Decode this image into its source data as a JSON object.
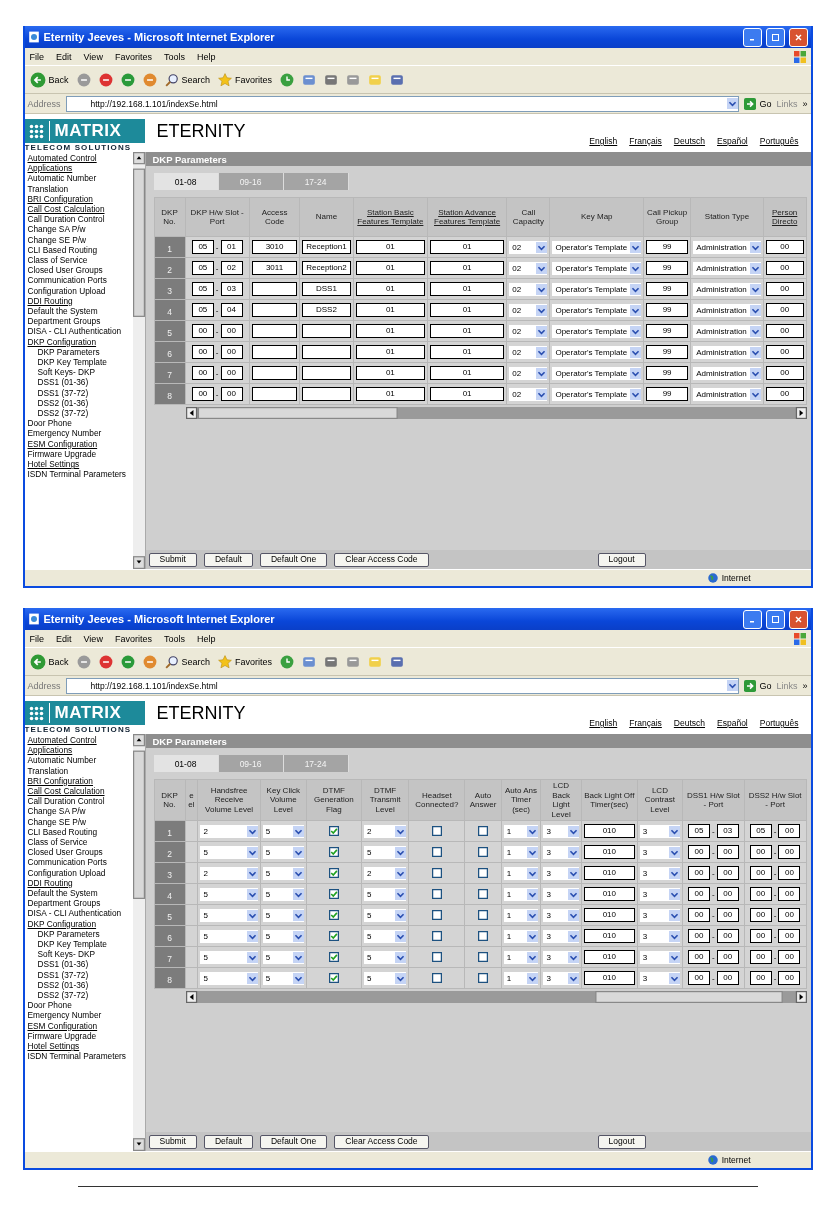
{
  "screens": [
    {
      "window": {
        "title": "Eternity Jeeves - Microsoft Internet Explorer"
      },
      "menu": [
        "File",
        "Edit",
        "View",
        "Favorites",
        "Tools",
        "Help"
      ],
      "toolbar": {
        "back": "Back",
        "search": "Search",
        "favorites": "Favorites"
      },
      "address": {
        "label": "Address",
        "url": "http://192.168.1.101/indexSe.html",
        "go": "Go",
        "links": "Links",
        "more": "»"
      },
      "logo": {
        "name": "MATRIX",
        "tagline": "TELECOM SOLUTIONS"
      },
      "product": "ETERNITY",
      "languages": [
        "English",
        "Français",
        "Deutsch",
        "Español",
        "Português"
      ],
      "sidebar": {
        "items": [
          {
            "label": "Automated Control Applications",
            "underlined": true
          },
          {
            "label": "Automatic Number Translation",
            "underlined": false
          },
          {
            "label": "BRI Configuration",
            "underlined": true
          },
          {
            "label": "Call Cost Calculation",
            "underlined": true
          },
          {
            "label": "Call Duration Control",
            "underlined": false
          },
          {
            "label": "Change SA P/w",
            "underlined": false
          },
          {
            "label": "Change SE P/w",
            "underlined": false
          },
          {
            "label": "CLI Based Routing",
            "underlined": false
          },
          {
            "label": "Class of Service",
            "underlined": false
          },
          {
            "label": "Closed User Groups",
            "underlined": false
          },
          {
            "label": "Communication Ports",
            "underlined": false
          },
          {
            "label": "Configuration Upload",
            "underlined": false
          },
          {
            "label": "DDI Routing",
            "underlined": true
          },
          {
            "label": "Default the System",
            "underlined": false
          },
          {
            "label": "Department Groups",
            "underlined": false
          },
          {
            "label": "DISA - CLI Authentication",
            "underlined": false
          },
          {
            "label": "DKP Configuration",
            "underlined": true,
            "children": [
              {
                "label": "DKP Parameters",
                "underlined": false
              },
              {
                "label": "DKP Key Template",
                "underlined": false
              },
              {
                "label": "Soft Keys- DKP",
                "underlined": false
              },
              {
                "label": "DSS1 (01-36)",
                "underlined": false
              },
              {
                "label": "DSS1 (37-72)",
                "underlined": false
              },
              {
                "label": "DSS2 (01-36)",
                "underlined": false
              },
              {
                "label": "DSS2 (37-72)",
                "underlined": false
              }
            ]
          },
          {
            "label": "Door Phone",
            "underlined": false
          },
          {
            "label": "Emergency Number",
            "underlined": false
          },
          {
            "label": "ESM Configuration",
            "underlined": true
          },
          {
            "label": "Firmware Upgrade",
            "underlined": false
          },
          {
            "label": "Hotel Settings",
            "underlined": true
          },
          {
            "label": "ISDN Terminal Parameters",
            "underlined": false
          }
        ]
      },
      "panel": {
        "title": "DKP Parameters",
        "tabs": [
          {
            "label": "01-08",
            "selected": true
          },
          {
            "label": "09-16",
            "selected": false
          },
          {
            "label": "17-24",
            "selected": false
          }
        ],
        "table": {
          "columns": [
            {
              "label": "DKP No.",
              "underlined": false
            },
            {
              "label": "DKP H/w Slot - Port",
              "underlined": false
            },
            {
              "label": "Access Code",
              "underlined": false
            },
            {
              "label": "Name",
              "underlined": false
            },
            {
              "label": "Station Basic Features Template",
              "underlined": true
            },
            {
              "label": "Station Advance Features Template",
              "underlined": true
            },
            {
              "label": "Call Capacity",
              "underlined": false
            },
            {
              "label": "Key Map",
              "underlined": false
            },
            {
              "label": "Call Pickup Group",
              "underlined": false
            },
            {
              "label": "Station Type",
              "underlined": false
            },
            {
              "label": "Person Directo",
              "underlined": true
            }
          ],
          "rows": [
            {
              "cells": [
                {
                  "kind": "number",
                  "value": "1"
                },
                {
                  "kind": "pair",
                  "values": [
                    "05",
                    "01"
                  ],
                  "separator": "-"
                },
                {
                  "kind": "input",
                  "value": "3010"
                },
                {
                  "kind": "input",
                  "value": "Reception1"
                },
                {
                  "kind": "input",
                  "value": "01"
                },
                {
                  "kind": "input",
                  "value": "01"
                },
                {
                  "kind": "select",
                  "value": "02"
                },
                {
                  "kind": "select",
                  "value": "Operator's Template"
                },
                {
                  "kind": "input",
                  "value": "99"
                },
                {
                  "kind": "select",
                  "value": "Administration"
                },
                {
                  "kind": "input",
                  "value": "00"
                }
              ]
            },
            {
              "cells": [
                {
                  "kind": "number",
                  "value": "2"
                },
                {
                  "kind": "pair",
                  "values": [
                    "05",
                    "02"
                  ],
                  "separator": "-"
                },
                {
                  "kind": "input",
                  "value": "3011"
                },
                {
                  "kind": "input",
                  "value": "Reception2"
                },
                {
                  "kind": "input",
                  "value": "01"
                },
                {
                  "kind": "input",
                  "value": "01"
                },
                {
                  "kind": "select",
                  "value": "02"
                },
                {
                  "kind": "select",
                  "value": "Operator's Template"
                },
                {
                  "kind": "input",
                  "value": "99"
                },
                {
                  "kind": "select",
                  "value": "Administration"
                },
                {
                  "kind": "input",
                  "value": "00"
                }
              ]
            },
            {
              "cells": [
                {
                  "kind": "number",
                  "value": "3"
                },
                {
                  "kind": "pair",
                  "values": [
                    "05",
                    "03"
                  ],
                  "separator": "-"
                },
                {
                  "kind": "input"
                },
                {
                  "kind": "input",
                  "value": "DSS1"
                },
                {
                  "kind": "input",
                  "value": "01"
                },
                {
                  "kind": "input",
                  "value": "01"
                },
                {
                  "kind": "select",
                  "value": "02"
                },
                {
                  "kind": "select",
                  "value": "Operator's Template"
                },
                {
                  "kind": "input",
                  "value": "99"
                },
                {
                  "kind": "select",
                  "value": "Administration"
                },
                {
                  "kind": "input",
                  "value": "00"
                }
              ]
            },
            {
              "cells": [
                {
                  "kind": "number",
                  "value": "4"
                },
                {
                  "kind": "pair",
                  "values": [
                    "05",
                    "04"
                  ],
                  "separator": "-"
                },
                {
                  "kind": "input"
                },
                {
                  "kind": "input",
                  "value": "DSS2"
                },
                {
                  "kind": "input",
                  "value": "01"
                },
                {
                  "kind": "input",
                  "value": "01"
                },
                {
                  "kind": "select",
                  "value": "02"
                },
                {
                  "kind": "select",
                  "value": "Operator's Template"
                },
                {
                  "kind": "input",
                  "value": "99"
                },
                {
                  "kind": "select",
                  "value": "Administration"
                },
                {
                  "kind": "input",
                  "value": "00"
                }
              ]
            },
            {
              "cells": [
                {
                  "kind": "number",
                  "value": "5"
                },
                {
                  "kind": "pair",
                  "values": [
                    "00",
                    "00"
                  ],
                  "separator": "-"
                },
                {
                  "kind": "input"
                },
                {
                  "kind": "input"
                },
                {
                  "kind": "input",
                  "value": "01"
                },
                {
                  "kind": "input",
                  "value": "01"
                },
                {
                  "kind": "select",
                  "value": "02"
                },
                {
                  "kind": "select",
                  "value": "Operator's Template"
                },
                {
                  "kind": "input",
                  "value": "99"
                },
                {
                  "kind": "select",
                  "value": "Administration"
                },
                {
                  "kind": "input",
                  "value": "00"
                }
              ]
            },
            {
              "cells": [
                {
                  "kind": "number",
                  "value": "6"
                },
                {
                  "kind": "pair",
                  "values": [
                    "00",
                    "00"
                  ],
                  "separator": "-"
                },
                {
                  "kind": "input"
                },
                {
                  "kind": "input"
                },
                {
                  "kind": "input",
                  "value": "01"
                },
                {
                  "kind": "input",
                  "value": "01"
                },
                {
                  "kind": "select",
                  "value": "02"
                },
                {
                  "kind": "select",
                  "value": "Operator's Template"
                },
                {
                  "kind": "input",
                  "value": "99"
                },
                {
                  "kind": "select",
                  "value": "Administration"
                },
                {
                  "kind": "input",
                  "value": "00"
                }
              ]
            },
            {
              "cells": [
                {
                  "kind": "number",
                  "value": "7"
                },
                {
                  "kind": "pair",
                  "values": [
                    "00",
                    "00"
                  ],
                  "separator": "-"
                },
                {
                  "kind": "input"
                },
                {
                  "kind": "input"
                },
                {
                  "kind": "input",
                  "value": "01"
                },
                {
                  "kind": "input",
                  "value": "01"
                },
                {
                  "kind": "select",
                  "value": "02"
                },
                {
                  "kind": "select",
                  "value": "Operator's Template"
                },
                {
                  "kind": "input",
                  "value": "99"
                },
                {
                  "kind": "select",
                  "value": "Administration"
                },
                {
                  "kind": "input",
                  "value": "00"
                }
              ]
            },
            {
              "cells": [
                {
                  "kind": "number",
                  "value": "8"
                },
                {
                  "kind": "pair",
                  "values": [
                    "00",
                    "00"
                  ],
                  "separator": "-"
                },
                {
                  "kind": "input"
                },
                {
                  "kind": "input"
                },
                {
                  "kind": "input",
                  "value": "01"
                },
                {
                  "kind": "input",
                  "value": "01"
                },
                {
                  "kind": "select",
                  "value": "02"
                },
                {
                  "kind": "select",
                  "value": "Operator's Template"
                },
                {
                  "kind": "input",
                  "value": "99"
                },
                {
                  "kind": "select",
                  "value": "Administration"
                },
                {
                  "kind": "input",
                  "value": "00"
                }
              ]
            }
          ]
        },
        "buttons": [
          "Submit",
          "Default",
          "Default One",
          "Clear Access Code"
        ],
        "logout": "Logout"
      },
      "status_bar": {
        "zone": "Internet"
      }
    },
    {
      "window": {
        "title": "Eternity Jeeves - Microsoft Internet Explorer"
      },
      "menu": [
        "File",
        "Edit",
        "View",
        "Favorites",
        "Tools",
        "Help"
      ],
      "toolbar": {
        "back": "Back",
        "search": "Search",
        "favorites": "Favorites"
      },
      "address": {
        "label": "Address",
        "url": "http://192.168.1.101/indexSe.html",
        "go": "Go",
        "links": "Links",
        "more": "»"
      },
      "logo": {
        "name": "MATRIX",
        "tagline": "TELECOM SOLUTIONS"
      },
      "product": "ETERNITY",
      "languages": [
        "English",
        "Français",
        "Deutsch",
        "Español",
        "Português"
      ],
      "sidebar": {
        "items": [
          {
            "label": "Automated Control Applications",
            "underlined": true
          },
          {
            "label": "Automatic Number Translation",
            "underlined": false
          },
          {
            "label": "BRI Configuration",
            "underlined": true
          },
          {
            "label": "Call Cost Calculation",
            "underlined": true
          },
          {
            "label": "Call Duration Control",
            "underlined": false
          },
          {
            "label": "Change SA P/w",
            "underlined": false
          },
          {
            "label": "Change SE P/w",
            "underlined": false
          },
          {
            "label": "CLI Based Routing",
            "underlined": false
          },
          {
            "label": "Class of Service",
            "underlined": false
          },
          {
            "label": "Closed User Groups",
            "underlined": false
          },
          {
            "label": "Communication Ports",
            "underlined": false
          },
          {
            "label": "Configuration Upload",
            "underlined": false
          },
          {
            "label": "DDI Routing",
            "underlined": true
          },
          {
            "label": "Default the System",
            "underlined": false
          },
          {
            "label": "Department Groups",
            "underlined": false
          },
          {
            "label": "DISA - CLI Authentication",
            "underlined": false
          },
          {
            "label": "DKP Configuration",
            "underlined": true,
            "children": [
              {
                "label": "DKP Parameters",
                "underlined": false
              },
              {
                "label": "DKP Key Template",
                "underlined": false
              },
              {
                "label": "Soft Keys- DKP",
                "underlined": false
              },
              {
                "label": "DSS1 (01-36)",
                "underlined": false
              },
              {
                "label": "DSS1 (37-72)",
                "underlined": false
              },
              {
                "label": "DSS2 (01-36)",
                "underlined": false
              },
              {
                "label": "DSS2 (37-72)",
                "underlined": false
              }
            ]
          },
          {
            "label": "Door Phone",
            "underlined": false
          },
          {
            "label": "Emergency Number",
            "underlined": false
          },
          {
            "label": "ESM Configuration",
            "underlined": true
          },
          {
            "label": "Firmware Upgrade",
            "underlined": false
          },
          {
            "label": "Hotel Settings",
            "underlined": true
          },
          {
            "label": "ISDN Terminal Parameters",
            "underlined": false
          }
        ]
      },
      "panel": {
        "title": "DKP Parameters",
        "tabs": [
          {
            "label": "01-08",
            "selected": true
          },
          {
            "label": "09-16",
            "selected": false
          },
          {
            "label": "17-24",
            "selected": false
          }
        ],
        "table": {
          "columns": [
            {
              "label": "DKP No.",
              "underlined": false
            },
            {
              "label": "e el",
              "underlined": false
            },
            {
              "label": "Handsfree Receive Volume Level",
              "underlined": false
            },
            {
              "label": "Key Click Volume Level",
              "underlined": false
            },
            {
              "label": "DTMF Generation Flag",
              "underlined": false
            },
            {
              "label": "DTMF Transmit Level",
              "underlined": false
            },
            {
              "label": "Headset Connected?",
              "underlined": false
            },
            {
              "label": "Auto Answer",
              "underlined": false
            },
            {
              "label": "Auto Ans Timer (sec)",
              "underlined": false
            },
            {
              "label": "LCD Back Light Level",
              "underlined": false
            },
            {
              "label": "Back Light Off Timer(sec)",
              "underlined": false
            },
            {
              "label": "LCD Contrast Level",
              "underlined": false
            },
            {
              "label": "DSS1 H/w Slot - Port",
              "underlined": false
            },
            {
              "label": "DSS2 H/w Slot - Port",
              "underlined": false
            }
          ],
          "rows": [
            {
              "cells": [
                {
                  "kind": "number",
                  "value": "1"
                },
                {
                  "kind": "blank"
                },
                {
                  "kind": "select",
                  "value": "2"
                },
                {
                  "kind": "select",
                  "value": "5"
                },
                {
                  "kind": "check",
                  "checked": true
                },
                {
                  "kind": "select",
                  "value": "2"
                },
                {
                  "kind": "check",
                  "checked": false
                },
                {
                  "kind": "check",
                  "checked": false
                },
                {
                  "kind": "select",
                  "value": "1"
                },
                {
                  "kind": "select",
                  "value": "3"
                },
                {
                  "kind": "input",
                  "value": "010"
                },
                {
                  "kind": "select",
                  "value": "3"
                },
                {
                  "kind": "pair",
                  "values": [
                    "05",
                    "03"
                  ],
                  "separator": "-"
                },
                {
                  "kind": "pair",
                  "values": [
                    "05",
                    "00"
                  ],
                  "separator": "-"
                }
              ]
            },
            {
              "cells": [
                {
                  "kind": "number",
                  "value": "2"
                },
                {
                  "kind": "blank"
                },
                {
                  "kind": "select",
                  "value": "5"
                },
                {
                  "kind": "select",
                  "value": "5"
                },
                {
                  "kind": "check",
                  "checked": true
                },
                {
                  "kind": "select",
                  "value": "5"
                },
                {
                  "kind": "check",
                  "checked": false
                },
                {
                  "kind": "check",
                  "checked": false
                },
                {
                  "kind": "select",
                  "value": "1"
                },
                {
                  "kind": "select",
                  "value": "3"
                },
                {
                  "kind": "input",
                  "value": "010"
                },
                {
                  "kind": "select",
                  "value": "3"
                },
                {
                  "kind": "pair",
                  "values": [
                    "00",
                    "00"
                  ],
                  "separator": "-"
                },
                {
                  "kind": "pair",
                  "values": [
                    "00",
                    "00"
                  ],
                  "separator": "-"
                }
              ]
            },
            {
              "cells": [
                {
                  "kind": "number",
                  "value": "3"
                },
                {
                  "kind": "blank"
                },
                {
                  "kind": "select",
                  "value": "2"
                },
                {
                  "kind": "select",
                  "value": "5"
                },
                {
                  "kind": "check",
                  "checked": true
                },
                {
                  "kind": "select",
                  "value": "2"
                },
                {
                  "kind": "check",
                  "checked": false
                },
                {
                  "kind": "check",
                  "checked": false
                },
                {
                  "kind": "select",
                  "value": "1"
                },
                {
                  "kind": "select",
                  "value": "3"
                },
                {
                  "kind": "input",
                  "value": "010"
                },
                {
                  "kind": "select",
                  "value": "3"
                },
                {
                  "kind": "pair",
                  "values": [
                    "00",
                    "00"
                  ],
                  "separator": "-"
                },
                {
                  "kind": "pair",
                  "values": [
                    "00",
                    "00"
                  ],
                  "separator": "-"
                }
              ]
            },
            {
              "cells": [
                {
                  "kind": "number",
                  "value": "4"
                },
                {
                  "kind": "blank"
                },
                {
                  "kind": "select",
                  "value": "5"
                },
                {
                  "kind": "select",
                  "value": "5"
                },
                {
                  "kind": "check",
                  "checked": true
                },
                {
                  "kind": "select",
                  "value": "5"
                },
                {
                  "kind": "check",
                  "checked": false
                },
                {
                  "kind": "check",
                  "checked": false
                },
                {
                  "kind": "select",
                  "value": "1"
                },
                {
                  "kind": "select",
                  "value": "3"
                },
                {
                  "kind": "input",
                  "value": "010"
                },
                {
                  "kind": "select",
                  "value": "3"
                },
                {
                  "kind": "pair",
                  "values": [
                    "00",
                    "00"
                  ],
                  "separator": "-"
                },
                {
                  "kind": "pair",
                  "values": [
                    "00",
                    "00"
                  ],
                  "separator": "-"
                }
              ]
            },
            {
              "cells": [
                {
                  "kind": "number",
                  "value": "5"
                },
                {
                  "kind": "blank"
                },
                {
                  "kind": "select",
                  "value": "5"
                },
                {
                  "kind": "select",
                  "value": "5"
                },
                {
                  "kind": "check",
                  "checked": true
                },
                {
                  "kind": "select",
                  "value": "5"
                },
                {
                  "kind": "check",
                  "checked": false
                },
                {
                  "kind": "check",
                  "checked": false
                },
                {
                  "kind": "select",
                  "value": "1"
                },
                {
                  "kind": "select",
                  "value": "3"
                },
                {
                  "kind": "input",
                  "value": "010"
                },
                {
                  "kind": "select",
                  "value": "3"
                },
                {
                  "kind": "pair",
                  "values": [
                    "00",
                    "00"
                  ],
                  "separator": "-"
                },
                {
                  "kind": "pair",
                  "values": [
                    "00",
                    "00"
                  ],
                  "separator": "-"
                }
              ]
            },
            {
              "cells": [
                {
                  "kind": "number",
                  "value": "6"
                },
                {
                  "kind": "blank"
                },
                {
                  "kind": "select",
                  "value": "5"
                },
                {
                  "kind": "select",
                  "value": "5"
                },
                {
                  "kind": "check",
                  "checked": true
                },
                {
                  "kind": "select",
                  "value": "5"
                },
                {
                  "kind": "check",
                  "checked": false
                },
                {
                  "kind": "check",
                  "checked": false
                },
                {
                  "kind": "select",
                  "value": "1"
                },
                {
                  "kind": "select",
                  "value": "3"
                },
                {
                  "kind": "input",
                  "value": "010"
                },
                {
                  "kind": "select",
                  "value": "3"
                },
                {
                  "kind": "pair",
                  "values": [
                    "00",
                    "00"
                  ],
                  "separator": "-"
                },
                {
                  "kind": "pair",
                  "values": [
                    "00",
                    "00"
                  ],
                  "separator": "-"
                }
              ]
            },
            {
              "cells": [
                {
                  "kind": "number",
                  "value": "7"
                },
                {
                  "kind": "blank"
                },
                {
                  "kind": "select",
                  "value": "5"
                },
                {
                  "kind": "select",
                  "value": "5"
                },
                {
                  "kind": "check",
                  "checked": true
                },
                {
                  "kind": "select",
                  "value": "5"
                },
                {
                  "kind": "check",
                  "checked": false
                },
                {
                  "kind": "check",
                  "checked": false
                },
                {
                  "kind": "select",
                  "value": "1"
                },
                {
                  "kind": "select",
                  "value": "3"
                },
                {
                  "kind": "input",
                  "value": "010"
                },
                {
                  "kind": "select",
                  "value": "3"
                },
                {
                  "kind": "pair",
                  "values": [
                    "00",
                    "00"
                  ],
                  "separator": "-"
                },
                {
                  "kind": "pair",
                  "values": [
                    "00",
                    "00"
                  ],
                  "separator": "-"
                }
              ]
            },
            {
              "cells": [
                {
                  "kind": "number",
                  "value": "8"
                },
                {
                  "kind": "blank"
                },
                {
                  "kind": "select",
                  "value": "5"
                },
                {
                  "kind": "select",
                  "value": "5"
                },
                {
                  "kind": "check",
                  "checked": true
                },
                {
                  "kind": "select",
                  "value": "5"
                },
                {
                  "kind": "check",
                  "checked": false
                },
                {
                  "kind": "check",
                  "checked": false
                },
                {
                  "kind": "select",
                  "value": "1"
                },
                {
                  "kind": "select",
                  "value": "3"
                },
                {
                  "kind": "input",
                  "value": "010"
                },
                {
                  "kind": "select",
                  "value": "3"
                },
                {
                  "kind": "pair",
                  "values": [
                    "00",
                    "00"
                  ],
                  "separator": "-"
                },
                {
                  "kind": "pair",
                  "values": [
                    "00",
                    "00"
                  ],
                  "separator": "-"
                }
              ]
            }
          ]
        },
        "buttons": [
          "Submit",
          "Default",
          "Default One",
          "Clear Access Code"
        ],
        "logout": "Logout"
      },
      "status_bar": {
        "zone": "Internet"
      }
    }
  ]
}
